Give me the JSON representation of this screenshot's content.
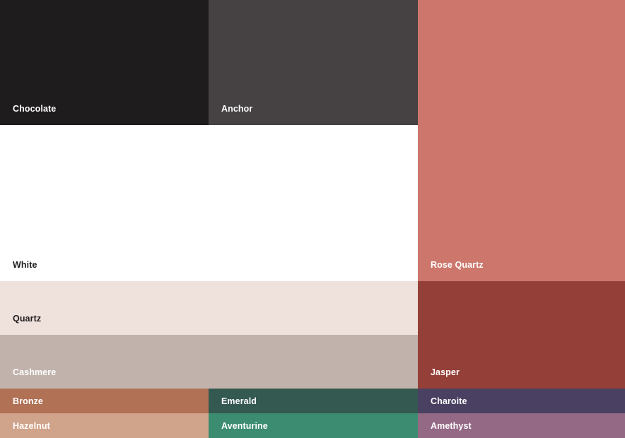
{
  "swatches": {
    "chocolate": {
      "label": "Chocolate",
      "color": "#1e1c1d",
      "text_color": "#ffffff"
    },
    "anchor": {
      "label": "Anchor",
      "color": "#464243",
      "text_color": "#ffffff"
    },
    "rose_quartz": {
      "label": "Rose Quartz",
      "color": "#cc766c",
      "text_color": "#ffffff"
    },
    "white": {
      "label": "White",
      "color": "#ffffff",
      "text_color": "#1e1c1d"
    },
    "quartz": {
      "label": "Quartz",
      "color": "#efe1dc",
      "text_color": "#1e1c1d"
    },
    "cashmere": {
      "label": "Cashmere",
      "color": "#c1b3ab",
      "text_color": "#ffffff"
    },
    "jasper": {
      "label": "Jasper",
      "color": "#953f39",
      "text_color": "#ffffff"
    },
    "bronze": {
      "label": "Bronze",
      "color": "#b17154",
      "text_color": "#ffffff"
    },
    "emerald": {
      "label": "Emerald",
      "color": "#345951",
      "text_color": "#ffffff"
    },
    "charoite": {
      "label": "Charoite",
      "color": "#4a4162",
      "text_color": "#ffffff"
    },
    "hazelnut": {
      "label": "Hazelnut",
      "color": "#d0a38b",
      "text_color": "#ffffff"
    },
    "aventurine": {
      "label": "Aventurine",
      "color": "#3c8c71",
      "text_color": "#ffffff"
    },
    "amethyst": {
      "label": "Amethyst",
      "color": "#946985",
      "text_color": "#ffffff"
    }
  }
}
